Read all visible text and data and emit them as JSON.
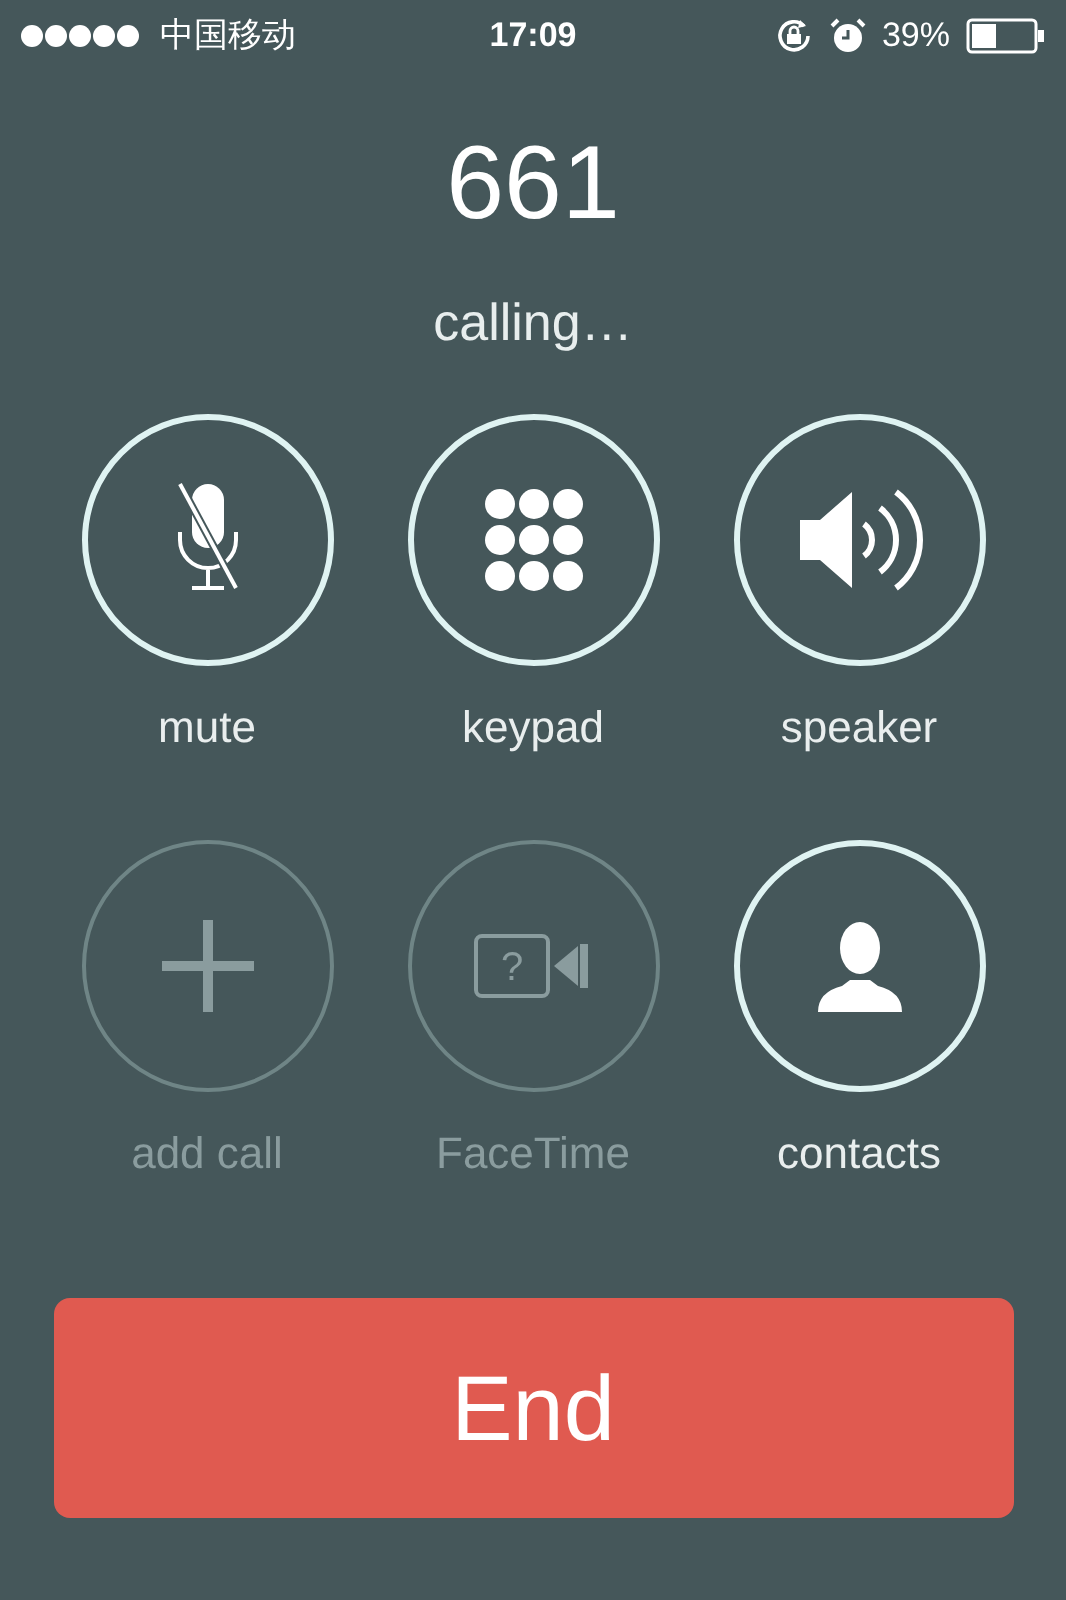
{
  "status_bar": {
    "carrier": "中国移动",
    "time": "17:09",
    "battery": "39%"
  },
  "call": {
    "number": "661",
    "status": "calling…"
  },
  "buttons": [
    {
      "kind": "mute",
      "label": "mute",
      "disabled": false
    },
    {
      "kind": "keypad",
      "label": "keypad",
      "disabled": false
    },
    {
      "kind": "speaker",
      "label": "speaker",
      "disabled": false
    },
    {
      "kind": "add",
      "label": "add call",
      "disabled": true
    },
    {
      "kind": "facetime",
      "label": "FaceTime",
      "disabled": true,
      "icon_text": "?"
    },
    {
      "kind": "contacts",
      "label": "contacts",
      "disabled": false
    }
  ],
  "end_button": {
    "label": "End"
  }
}
